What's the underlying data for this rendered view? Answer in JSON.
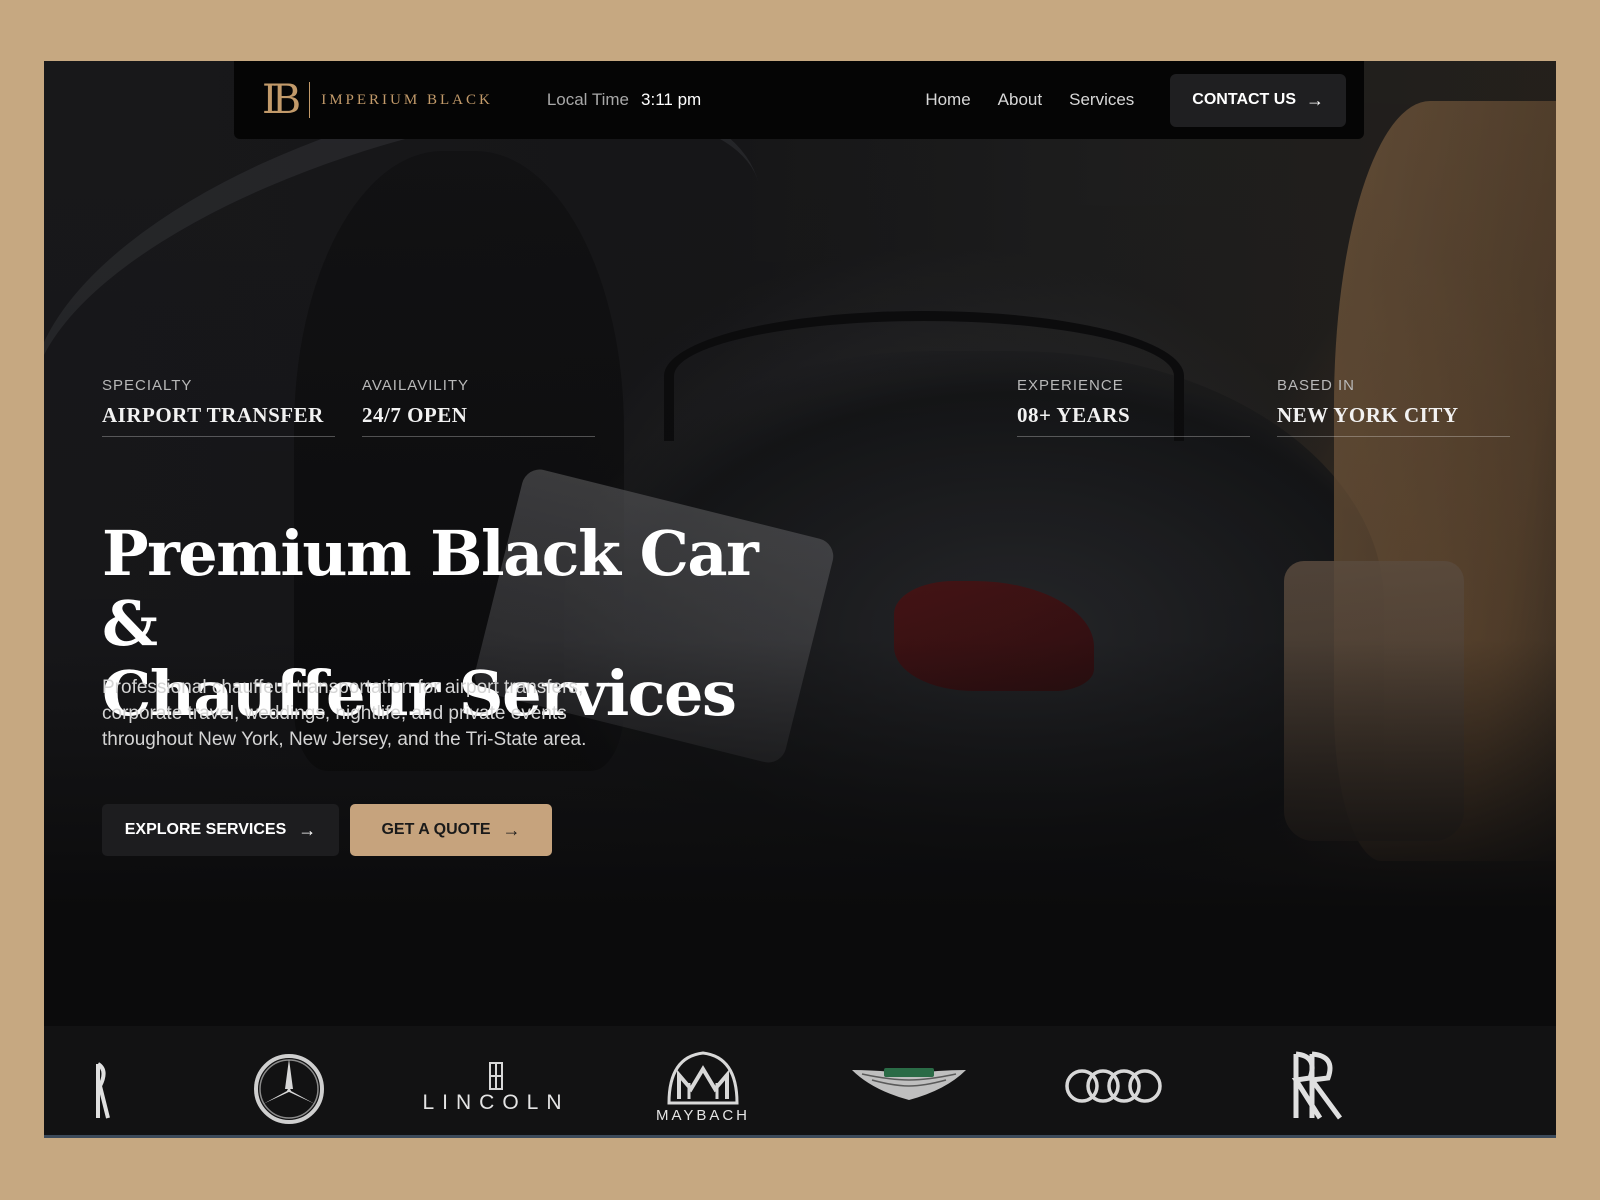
{
  "nav": {
    "brand_name": "IMPERIUM BLACK",
    "brand_monogram": "IB",
    "local_time_label": "Local Time",
    "local_time_value": "3:11 pm",
    "links": [
      "Home",
      "About",
      "Services"
    ],
    "contact_label": "CONTACT US"
  },
  "stats": [
    {
      "label": "SPECIALTY",
      "value": "AIRPORT TRANSFER"
    },
    {
      "label": "AVAILAVILITY",
      "value": "24/7 OPEN"
    },
    {
      "label": "EXPERIENCE",
      "value": "08+ YEARS"
    },
    {
      "label": "BASED IN",
      "value": "NEW YORK CITY"
    }
  ],
  "hero": {
    "headline_line1": "Premium Black Car &",
    "headline_line2": "Chauffeur Services",
    "subtext": "Professional chauffeur transportation for airport transfers, corporate travel, weddings, nightlife, and private events throughout New York, New Jersey, and the Tri-State area.",
    "primary_button": "EXPLORE SERVICES",
    "secondary_button": "GET A QUOTE"
  },
  "brands": {
    "lincoln": "LINCOLN",
    "maybach": "MAYBACH",
    "items": [
      "rolls-royce-partial-logo",
      "mercedes-benz-logo",
      "lincoln-logo",
      "maybach-logo",
      "aston-martin-logo",
      "audi-logo",
      "rolls-royce-logo"
    ]
  },
  "colors": {
    "page_background": "#c6a881",
    "accent_gold": "#c6a37d",
    "logo_gold": "#c29a6a",
    "dark_surface": "#050505"
  },
  "icons": {
    "arrow": "→"
  }
}
